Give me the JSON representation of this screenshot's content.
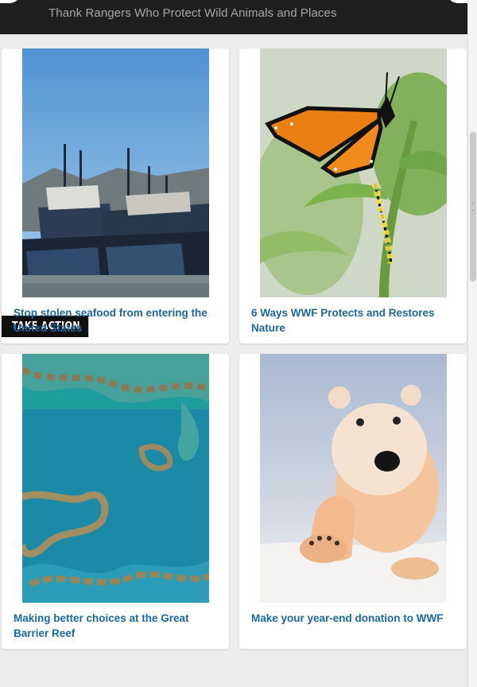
{
  "banner": {
    "text": "Thank Rangers Who Protect Wild Animals and Places"
  },
  "cards": [
    {
      "title": "Stop stolen seafood from entering the United States",
      "badge": "TAKE ACTION",
      "image": "fishing-boats-harbor"
    },
    {
      "title": "6 Ways WWF Protects and Restores Nature",
      "image": "monarch-butterfly-caterpillar"
    },
    {
      "title": "Making better choices at the Great Barrier Reef",
      "image": "great-barrier-reef-aerial"
    },
    {
      "title": "Make your year-end donation to WWF",
      "image": "polar-bear-cub"
    }
  ],
  "colors": {
    "link": "#1b67a1",
    "banner_bg": "#1f1f1f",
    "page_bg": "#ececec"
  }
}
